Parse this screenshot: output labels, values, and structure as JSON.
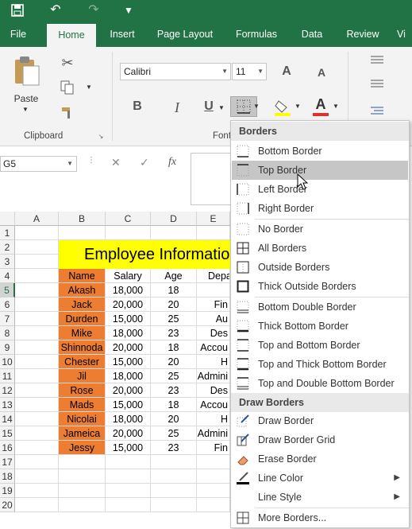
{
  "qat": {
    "save_icon": "save-icon",
    "undo_icon": "undo-icon",
    "redo_icon": "redo-icon",
    "customize_icon": "customize-icon"
  },
  "tabs": [
    "File",
    "Home",
    "Insert",
    "Page Layout",
    "Formulas",
    "Data",
    "Review",
    "Vi"
  ],
  "ribbon": {
    "paste_label": "Paste",
    "clipboard_label": "Clipboard",
    "font_group_label": "Font",
    "font_name": "Calibri",
    "font_size": "11",
    "bold": "B",
    "italic": "I",
    "underline": "U",
    "grow_font": "A",
    "shrink_font": "A",
    "font_color": "A"
  },
  "formula_bar": {
    "name_box": "G5",
    "fx": "fx"
  },
  "sheet": {
    "columns": [
      "A",
      "B",
      "C",
      "D",
      "E"
    ],
    "rows": [
      "1",
      "2",
      "3",
      "4",
      "5",
      "6",
      "7",
      "8",
      "9",
      "10",
      "11",
      "12",
      "13",
      "14",
      "15",
      "16",
      "17",
      "18",
      "19",
      "20"
    ],
    "title": "Employee Information",
    "headers": [
      "Name",
      "Salary",
      "Age",
      "Department"
    ],
    "data": [
      [
        "Akash",
        "18,000",
        "18",
        ""
      ],
      [
        "Jack",
        "20,000",
        "20",
        "Fin"
      ],
      [
        "Durden",
        "15,000",
        "25",
        "Au"
      ],
      [
        "Mike",
        "18,000",
        "23",
        "Des"
      ],
      [
        "Shinnoda",
        "20,000",
        "18",
        "Accou"
      ],
      [
        "Chester",
        "15,000",
        "20",
        "H"
      ],
      [
        "Jil",
        "18,000",
        "25",
        "Admini"
      ],
      [
        "Rose",
        "20,000",
        "23",
        "Des"
      ],
      [
        "Mads",
        "15,000",
        "18",
        "Accou"
      ],
      [
        "Nicolai",
        "18,000",
        "20",
        "H"
      ],
      [
        "Jameica",
        "20,000",
        "25",
        "Admini"
      ],
      [
        "Jessy",
        "15,000",
        "23",
        "Fin"
      ]
    ],
    "name_fill": "#ed7d31",
    "title_fill": "#ffff00"
  },
  "menu": {
    "borders_header": "Borders",
    "draw_header": "Draw Borders",
    "border_items": [
      "Bottom Border",
      "Top Border",
      "Left Border",
      "Right Border",
      "No Border",
      "All Borders",
      "Outside Borders",
      "Thick Outside Borders",
      "Bottom Double Border",
      "Thick Bottom Border",
      "Top and Bottom Border",
      "Top and Thick Bottom Border",
      "Top and Double Bottom Border"
    ],
    "draw_items": [
      "Draw Border",
      "Draw Border Grid",
      "Erase Border",
      "Line Color",
      "Line Style"
    ],
    "more": "More Borders...",
    "highlighted": "Top Border"
  },
  "colors": {
    "accent": "#217346",
    "highlight": "#c6c6c6"
  }
}
